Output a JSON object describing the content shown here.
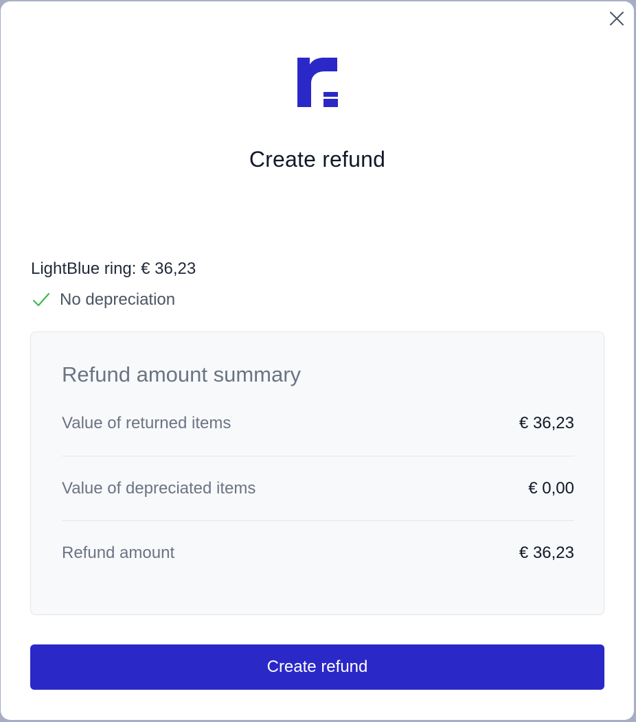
{
  "modal": {
    "title": "Create refund",
    "close_icon": "close-icon",
    "logo_icon": "brand-r-logo"
  },
  "item": {
    "line": "LightBlue ring: € 36,23",
    "status_icon": "checkmark-icon",
    "status_text": "No depreciation"
  },
  "summary": {
    "title": "Refund amount summary",
    "rows": [
      {
        "label": "Value of returned items",
        "value": "€ 36,23"
      },
      {
        "label": "Value of depreciated items",
        "value": "€ 0,00"
      },
      {
        "label": "Refund amount",
        "value": "€ 36,23"
      }
    ]
  },
  "actions": {
    "primary_label": "Create refund"
  },
  "colors": {
    "brand": "#2b28c8",
    "check": "#3fb950"
  }
}
